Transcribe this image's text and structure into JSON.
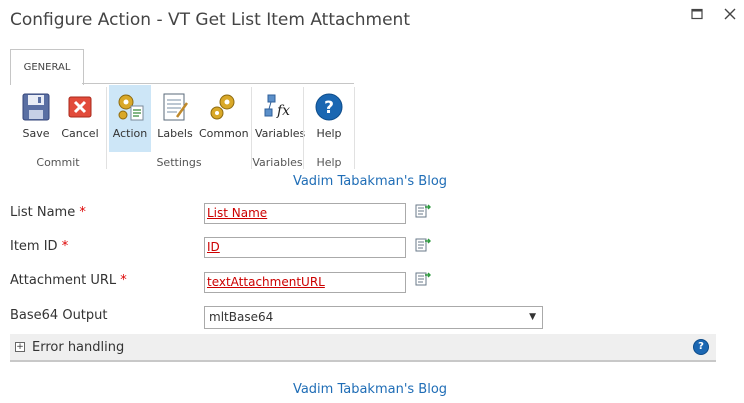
{
  "dialog": {
    "title": "Configure Action - VT Get List Item Attachment",
    "maximize_icon": "maximize-icon",
    "close_icon": "close-icon"
  },
  "ribbon": {
    "tab_label": "GENERAL",
    "groups": [
      {
        "label": "Commit",
        "buttons": [
          {
            "label": "Save",
            "icon": "floppy-disk-icon"
          },
          {
            "label": "Cancel",
            "icon": "red-x-icon"
          }
        ]
      },
      {
        "label": "Settings",
        "buttons": [
          {
            "label": "Action",
            "icon": "action-gears-icon",
            "selected": true
          },
          {
            "label": "Labels",
            "icon": "notepad-icon"
          },
          {
            "label": "Common",
            "icon": "gears-icon"
          }
        ]
      },
      {
        "label": "Variables",
        "buttons": [
          {
            "label": "Variables",
            "icon": "fx-variables-icon"
          }
        ]
      },
      {
        "label": "Help",
        "buttons": [
          {
            "label": "Help",
            "icon": "question-icon"
          }
        ]
      }
    ]
  },
  "blog_header": "Vadim Tabakman's Blog",
  "form": {
    "list_name": {
      "label": "List Name",
      "required_mark": "*",
      "value": "List Name"
    },
    "item_id": {
      "label": "Item ID",
      "required_mark": "*",
      "value": "ID"
    },
    "attachment_url": {
      "label": "Attachment URL",
      "required_mark": "*",
      "value": "textAttachmentURL"
    },
    "base64_output": {
      "label": "Base64 Output",
      "value": "mltBase64"
    }
  },
  "error_handling": {
    "toggle": "+",
    "label": "Error handling",
    "help": "?"
  },
  "blog_footer": "Vadim Tabakman's Blog",
  "colors": {
    "link": "#1f6db6",
    "required": "#dd0000",
    "selected_button": "#cde6f7",
    "value_text": "#cc0000"
  }
}
